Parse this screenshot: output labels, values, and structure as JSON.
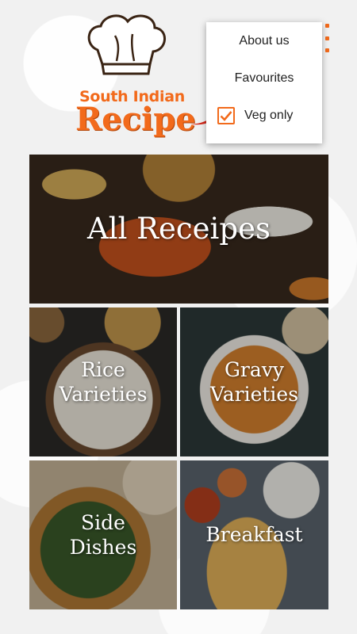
{
  "logo": {
    "line1": "South Indian",
    "line2": "Recipe",
    "hat_icon": "chef-hat-icon"
  },
  "menu": {
    "items": [
      {
        "label": "About us"
      },
      {
        "label": "Favourites"
      },
      {
        "label": "Veg only",
        "checked": true
      }
    ]
  },
  "tiles": {
    "all": "All Receipes",
    "rice": [
      "Rice",
      "Varieties"
    ],
    "gravy": [
      "Gravy",
      "Varieties"
    ],
    "side": [
      "Side",
      "Dishes"
    ],
    "breakfast": "Breakfast"
  },
  "colors": {
    "accent": "#f26a1b",
    "background": "#f1f1f1"
  }
}
